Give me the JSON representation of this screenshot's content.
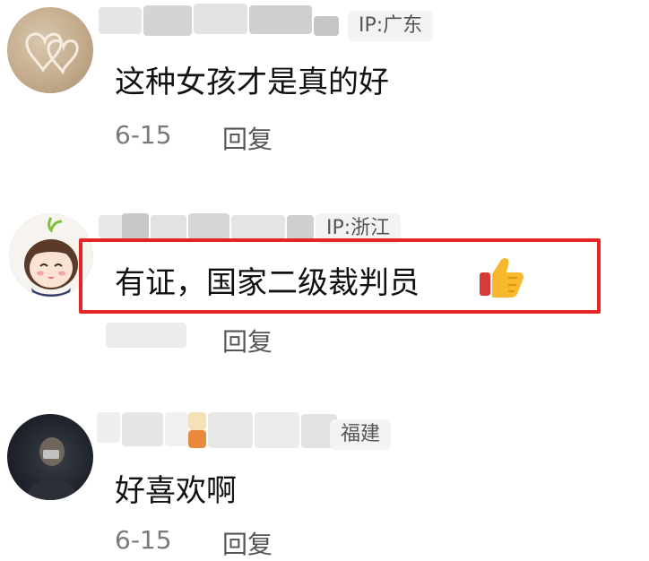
{
  "comments": [
    {
      "ip": "IP:广东",
      "text": "这种女孩才是真的好",
      "date": "6-15",
      "reply": "回复"
    },
    {
      "ip": "IP:浙江",
      "text": "有证，国家二级裁判员",
      "reply": "回复",
      "emoji": "thumbs-up-icon"
    },
    {
      "ip": "福建",
      "text": "好喜欢啊",
      "date": "6-15",
      "reply": "回复"
    }
  ],
  "colors": {
    "highlight_border": "#e52525",
    "text": "#111111",
    "meta": "#7a7a7a"
  }
}
